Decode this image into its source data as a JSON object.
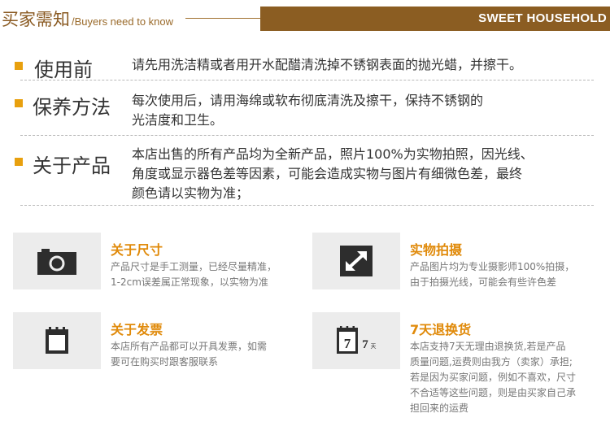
{
  "header": {
    "title_cn": "买家需知",
    "title_en": "/Buyers need to know",
    "brand": "SWEET HOUSEHOLD"
  },
  "sections": [
    {
      "heading": "使用前",
      "lines": [
        "请先用洗洁精或者用开水配醋清洗掉不锈钢表面的抛光蜡，并擦干。"
      ]
    },
    {
      "heading": "保养方法",
      "lines": [
        "每次使用后，请用海绵或软布彻底清洗及擦干，保持不锈钢的",
        "光洁度和卫生。"
      ]
    },
    {
      "heading": "关于产品",
      "lines": [
        "本店出售的所有产品均为全新产品，照片100%为实物拍照，因光线、",
        "角度或显示器色差等因素，可能会造成实物与图片有细微色差，最终",
        "颜色请以实物为准；"
      ]
    }
  ],
  "cards": [
    {
      "icon": "camera-icon",
      "title": "关于尺寸",
      "lines": [
        "产品尺寸是手工测量，已经尽量精准，",
        "1-2cm误差属正常现象，以实物为准"
      ]
    },
    {
      "icon": "expand-arrow-icon",
      "title": "实物拍摄",
      "lines": [
        "产品图片均为专业摄影师100%拍摄，",
        "由于拍摄光线，可能会有些许色差"
      ]
    },
    {
      "icon": "notepad-icon",
      "title": "关于发票",
      "lines": [
        "本店所有产品都可以开具发票，如需",
        "要可在购买时跟客服联系"
      ]
    },
    {
      "icon": "calendar-7-days-icon",
      "title": "7天退换货",
      "icon_text": [
        "7",
        "7",
        "天"
      ],
      "lines": [
        "本店支持7天无理由退换货,若是产品",
        "质量问题,运费则由我方（卖家）承担;",
        "若是因为买家问题，例如不喜欢，尺寸",
        "不合适等这些问题，则是由买家自己承",
        "担回来的运费"
      ]
    }
  ]
}
